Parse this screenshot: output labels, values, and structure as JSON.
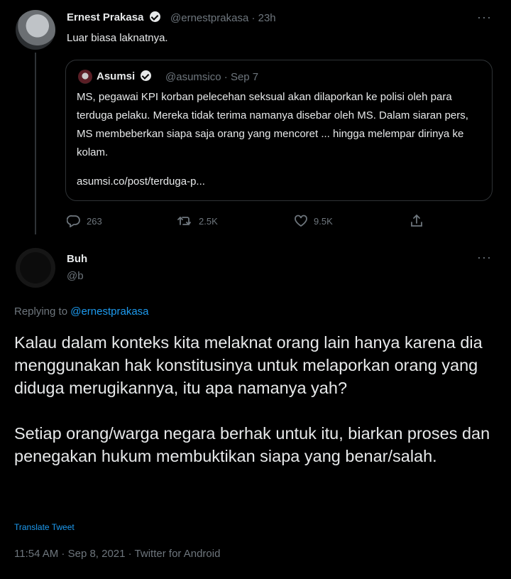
{
  "original_tweet": {
    "name": "Ernest Prakasa",
    "handle": "@ernestprakasa",
    "time": "23h",
    "text": "Luar biasa laknatnya.",
    "quoted": {
      "name": "Asumsi",
      "handle": "@asumsico",
      "date": "Sep 7",
      "text": "MS, pegawai KPI korban pelecehan seksual akan dilaporkan ke polisi oleh para terduga pelaku. Mereka tidak terima namanya disebar oleh MS. Dalam siaran pers, MS membeberkan siapa saja orang yang mencoret ... hingga melempar dirinya ke kolam.",
      "link": "asumsi.co/post/terduga-p..."
    },
    "stats": {
      "replies": "263",
      "retweets": "2.5K",
      "likes": "9.5K"
    }
  },
  "reply_tweet": {
    "name": "Buh",
    "handle": "@b",
    "replying_prefix": "Replying to",
    "replying_to": "@ernestprakasa",
    "paragraphs": [
      "Kalau dalam konteks kita melaknat orang lain hanya karena dia menggunakan hak konstitusinya untuk melaporkan orang yang diduga merugikannya, itu apa namanya yah?",
      "Setiap orang/warga negara berhak untuk itu, biarkan proses dan penegakan hukum membuktikan siapa yang benar/salah."
    ],
    "translate_label": "Translate Tweet",
    "timestamp": "11:54 AM · Sep 8, 2021 · Twitter for Android"
  },
  "ui": {
    "more_glyph": "···",
    "dot_sep": " · "
  }
}
